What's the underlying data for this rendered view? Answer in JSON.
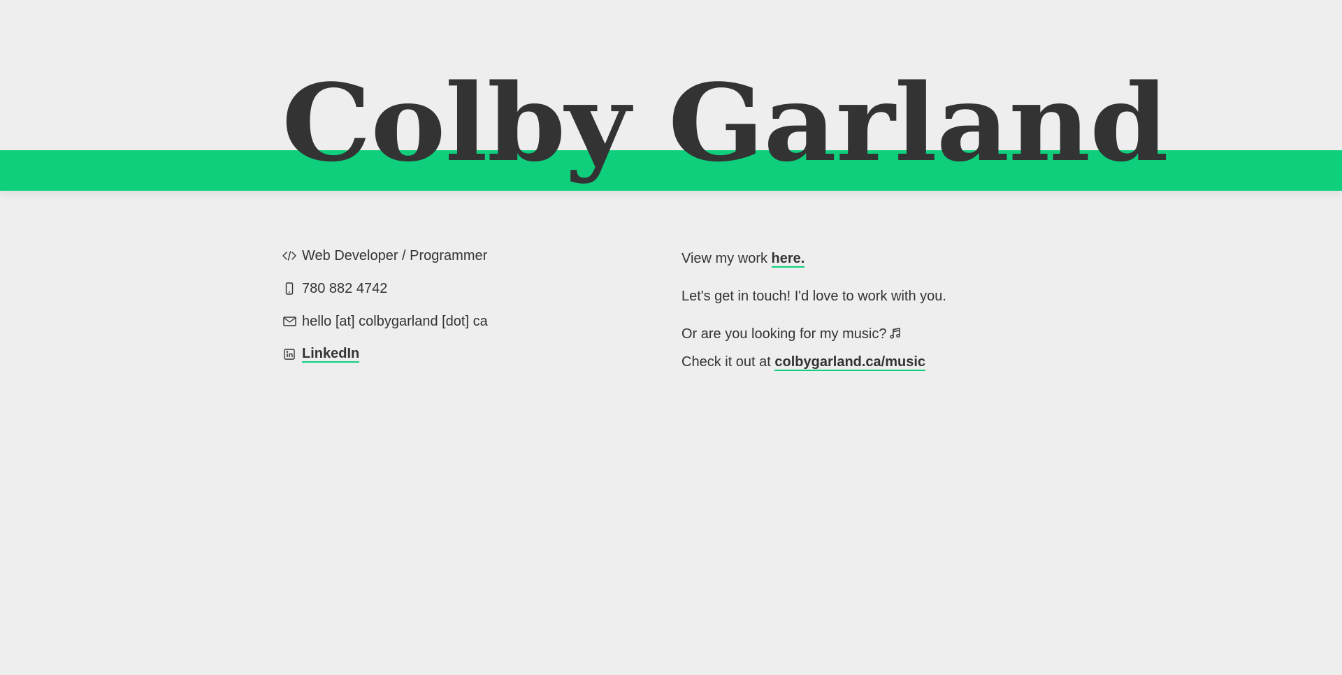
{
  "header": {
    "name": "Colby Garland",
    "band_color": "#0fcf7d"
  },
  "contact": {
    "role": {
      "icon": "code-icon",
      "text": "Web Developer / Programmer"
    },
    "phone": {
      "icon": "phone-icon",
      "text": "780 882 4742"
    },
    "email": {
      "icon": "mail-icon",
      "text": "hello [at] colbygarland [dot] ca"
    },
    "linkedin": {
      "icon": "linkedin-icon",
      "text": "LinkedIn"
    }
  },
  "about": {
    "work_prefix": "View my work ",
    "work_link": "here.",
    "touch": "Let's get in touch! I'd love to work with you.",
    "music_question": "Or are you looking for my music?",
    "music_icon": "music-note-icon",
    "music_prefix": "Check it out at ",
    "music_link": "colbygarland.ca/music"
  }
}
